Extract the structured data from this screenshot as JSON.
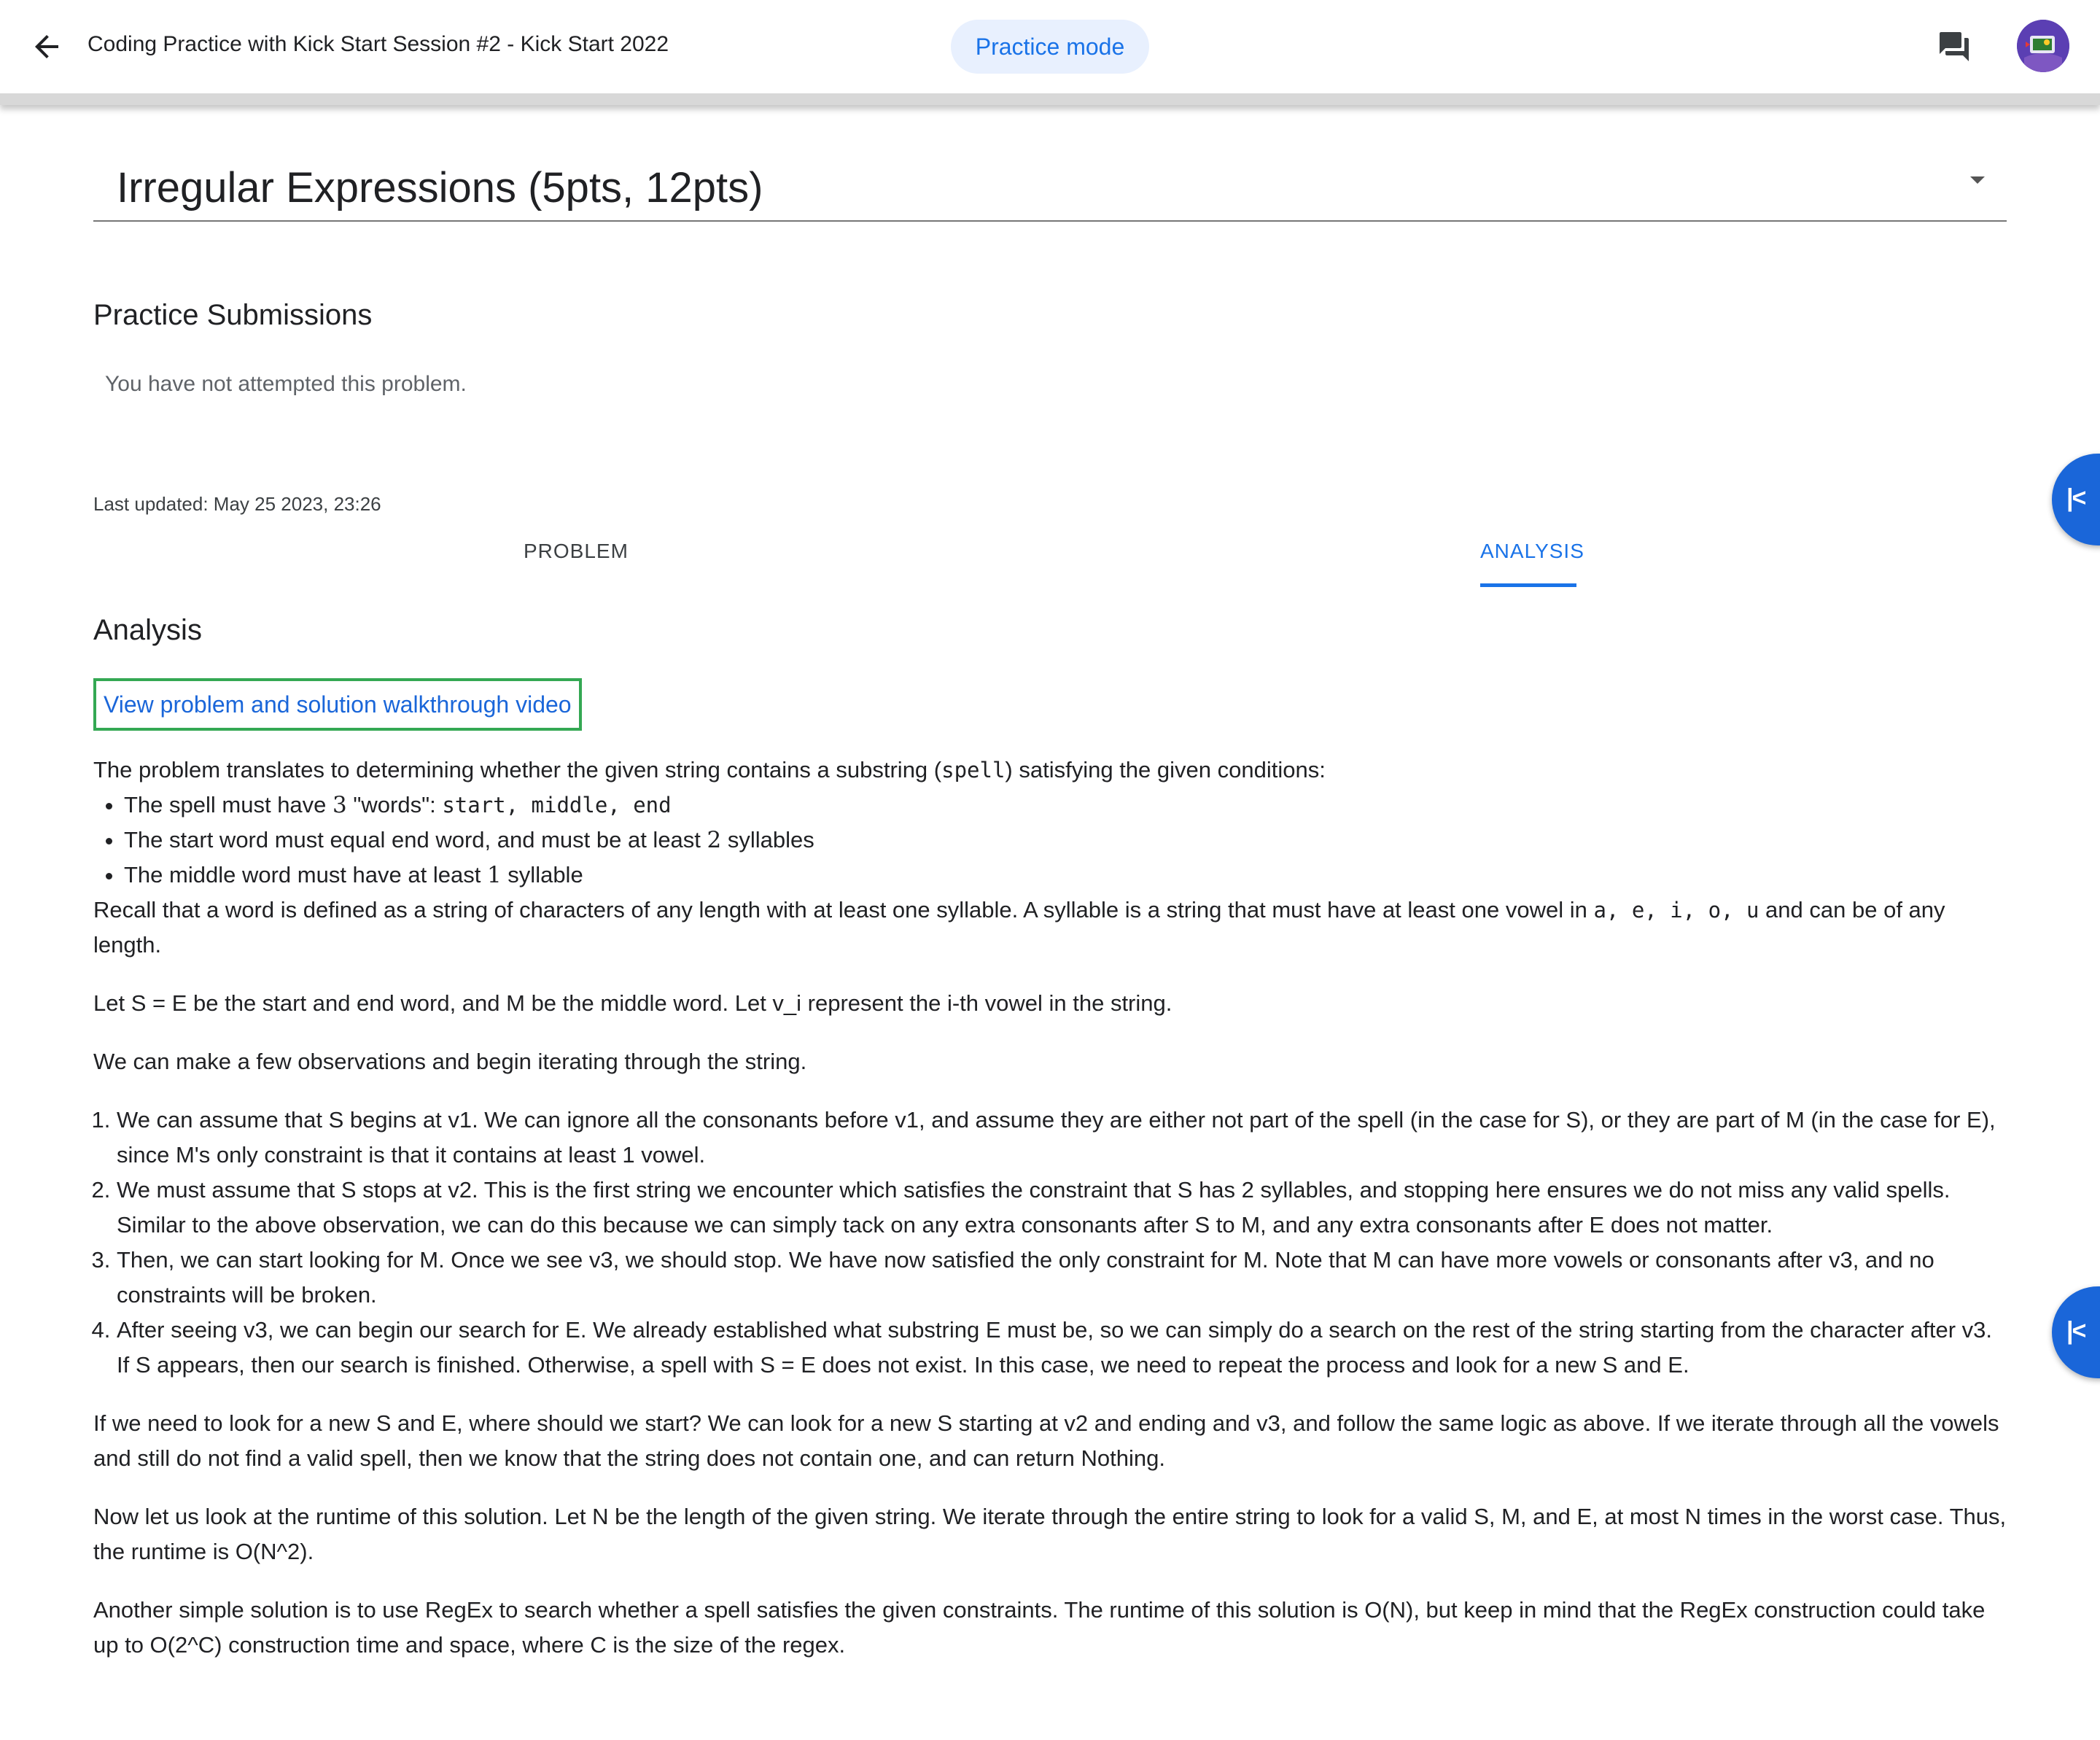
{
  "header": {
    "title": "Coding Practice with Kick Start Session #2 - Kick Start 2022",
    "mode_chip": "Practice mode",
    "icons": {
      "back": "arrow-back-icon",
      "chat": "chat-icon",
      "avatar": "user-avatar"
    }
  },
  "problem_selector": {
    "selected": "Irregular Expressions (5pts, 12pts)"
  },
  "submissions": {
    "heading": "Practice Submissions",
    "status": "You have not attempted this problem."
  },
  "last_updated": "Last updated: May 25 2023, 23:26",
  "tabs": [
    {
      "label": "PROBLEM",
      "active": false
    },
    {
      "label": "ANALYSIS",
      "active": true
    }
  ],
  "side_buttons": [
    "collapse-panel-icon",
    "collapse-panel-icon"
  ],
  "analysis": {
    "heading": "Analysis",
    "video_link": "View problem and solution walkthrough video",
    "intro_a": "The problem translates to determining whether the given string contains a substring (",
    "intro_code": "spell",
    "intro_b": ") satisfying the given conditions:",
    "bullet1_a": "The spell must have ",
    "bullet1_num": "3",
    "bullet1_b": " \"words\": ",
    "bullet1_code": "start, middle, end",
    "bullet2_a": "The start word must equal end word, and must be at least ",
    "bullet2_num": "2",
    "bullet2_b": " syllables",
    "bullet3_a": "The middle word must have at least ",
    "bullet3_num": "1",
    "bullet3_b": " syllable",
    "recall_a": "Recall that a word is defined as a string of characters of any length with at least one syllable. A syllable is a string that must have at least one vowel in ",
    "recall_code": "a, e, i, o, u",
    "recall_b": " and can be of any length.",
    "let_text": "Let S = E be the start and end word, and M be the middle word. Let v_i represent the i-th vowel in the string.",
    "observe": "We can make a few observations and begin iterating through the string.",
    "steps": [
      "We can assume that S begins at v1. We can ignore all the consonants before v1, and assume they are either not part of the spell (in the case for S), or they are part of M (in the case for E), since M's only constraint is that it contains at least 1 vowel.",
      "We must assume that S stops at v2. This is the first string we encounter which satisfies the constraint that S has 2 syllables, and stopping here ensures we do not miss any valid spells. Similar to the above observation, we can do this because we can simply tack on any extra consonants after S to M, and any extra consonants after E does not matter.",
      "Then, we can start looking for M. Once we see v3, we should stop. We have now satisfied the only constraint for M. Note that M can have more vowels or consonants after v3, and no constraints will be broken.",
      "After seeing v3, we can begin our search for E. We already established what substring E must be, so we can simply do a search on the rest of the string starting from the character after v3. If S appears, then our search is finished. Otherwise, a spell with S = E does not exist. In this case, we need to repeat the process and look for a new S and E."
    ],
    "restart_text": "If we need to look for a new S and E, where should we start? We can look for a new S starting at v2 and ending and v3, and follow the same logic as above. If we iterate through all the vowels and still do not find a valid spell, then we know that the string does not contain one, and can return Nothing.",
    "runtime_text": "Now let us look at the runtime of this solution. Let N be the length of the given string. We iterate through the entire string to look for a valid S, M, and E, at most N times in the worst case. Thus, the runtime is O(N^2).",
    "regex_text": "Another simple solution is to use RegEx to search whether a spell satisfies the given constraints. The runtime of this solution is O(N), but keep in mind that the RegEx construction could take up to O(2^C) construction time and space, where C is the size of the regex."
  },
  "colors": {
    "accent": "#1a73e8",
    "chip_bg": "#e8f0fe",
    "link_border": "#34a853",
    "side_button": "#1a66d9"
  }
}
